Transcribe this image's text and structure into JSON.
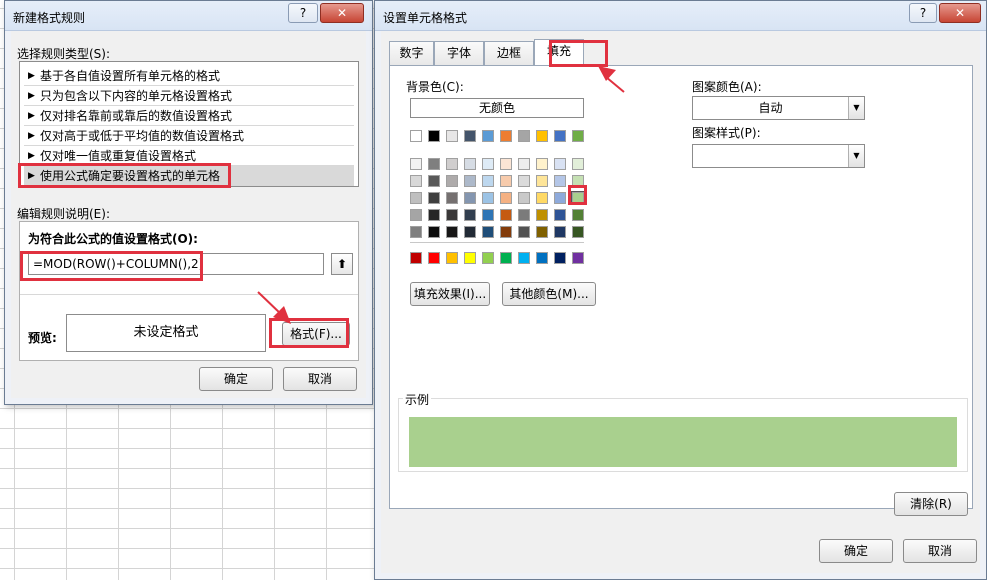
{
  "left_dialog": {
    "title": "新建格式规则",
    "help_label": "?",
    "close_label": "✕",
    "select_type_label": "选择规则类型(S):",
    "rule_types": [
      "基于各自值设置所有单元格的格式",
      "只为包含以下内容的单元格设置格式",
      "仅对排名靠前或靠后的数值设置格式",
      "仅对高于或低于平均值的数值设置格式",
      "仅对唯一值或重复值设置格式",
      "使用公式确定要设置格式的单元格"
    ],
    "selected_rule_index": 5,
    "edit_desc_label": "编辑规则说明(E):",
    "formula_label": "为符合此公式的值设置格式(O):",
    "formula_value": "=MOD(ROW()+COLUMN(),2)",
    "preview_label": "预览:",
    "preview_text": "未设定格式",
    "format_button": "格式(F)...",
    "ok_button": "确定",
    "cancel_button": "取消"
  },
  "right_dialog": {
    "title": "设置单元格格式",
    "help_label": "?",
    "close_label": "✕",
    "tabs": [
      "数字",
      "字体",
      "边框",
      "填充"
    ],
    "active_tab": "填充",
    "bg_color_label": "背景色(C):",
    "no_color_button": "无颜色",
    "fill_effects_button": "填充效果(I)...",
    "more_colors_button": "其他颜色(M)...",
    "pattern_color_label": "图案颜色(A):",
    "pattern_color_value": "自动",
    "pattern_style_label": "图案样式(P):",
    "pattern_style_value": "",
    "sample_label": "示例",
    "sample_color": "#a9d08e",
    "clear_button": "清除(R)",
    "ok_button": "确定",
    "cancel_button": "取消",
    "palette_top": [
      "#ffffff",
      "#000000",
      "#e7e6e6",
      "#44546a",
      "#5b9bd5",
      "#ed7d31",
      "#a5a5a5",
      "#ffc000",
      "#4472c4",
      "#70ad47"
    ],
    "palette_tints": [
      [
        "#f2f2f2",
        "#7f7f7f",
        "#d0cece",
        "#d6dce4",
        "#deebf6",
        "#fbe5d5",
        "#ededed",
        "#fff2cc",
        "#d9e2f3",
        "#e2efd9"
      ],
      [
        "#d8d8d8",
        "#595959",
        "#aeabab",
        "#adb9ca",
        "#bdd7ee",
        "#f7cbac",
        "#dbdbdb",
        "#fee599",
        "#b4c6e7",
        "#c5e0b3"
      ],
      [
        "#bfbfbf",
        "#3f3f3f",
        "#757070",
        "#8496b0",
        "#9cc3e5",
        "#f4b183",
        "#c9c9c9",
        "#ffd965",
        "#8eaadb",
        "#a8d08d"
      ],
      [
        "#a5a5a5",
        "#262626",
        "#3a3838",
        "#323f4f",
        "#2e75b5",
        "#c55a11",
        "#7b7b7b",
        "#bf9000",
        "#2f5496",
        "#538135"
      ],
      [
        "#7f7f7f",
        "#0c0c0c",
        "#171616",
        "#222a35",
        "#1f4e79",
        "#833c0b",
        "#525252",
        "#7f6000",
        "#1f3864",
        "#375623"
      ]
    ],
    "palette_standard": [
      "#c00000",
      "#ff0000",
      "#ffc000",
      "#ffff00",
      "#92d050",
      "#00b050",
      "#00b0f0",
      "#0070c0",
      "#002060",
      "#7030a0"
    ],
    "selected_swatch": {
      "row": 2,
      "col": 9
    }
  }
}
